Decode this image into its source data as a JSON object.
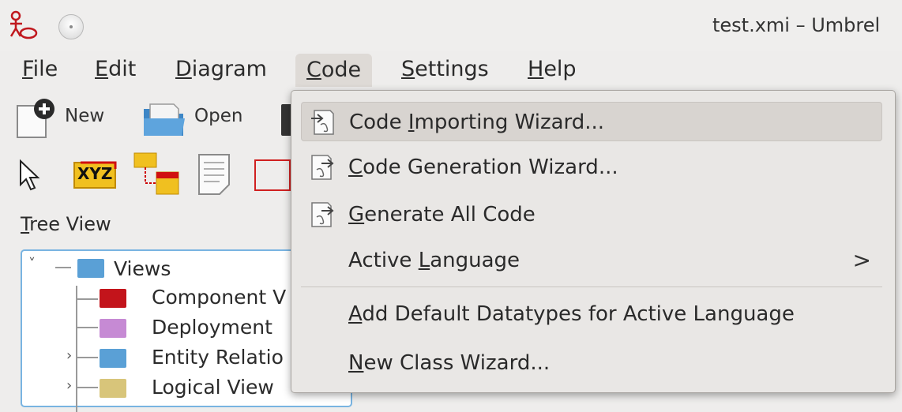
{
  "window": {
    "title": "test.xmi – Umbrel"
  },
  "menubar": {
    "items": [
      {
        "pre": "",
        "u": "F",
        "post": "ile"
      },
      {
        "pre": "",
        "u": "E",
        "post": "dit"
      },
      {
        "pre": "",
        "u": "D",
        "post": "iagram"
      },
      {
        "pre": "",
        "u": "C",
        "post": "ode"
      },
      {
        "pre": "",
        "u": "S",
        "post": "ettings"
      },
      {
        "pre": "",
        "u": "H",
        "post": "elp"
      }
    ]
  },
  "toolbar": {
    "new_label": "New",
    "open_label": "Open",
    "xyz_label": "XYZ"
  },
  "tree": {
    "title_u": "T",
    "title_rest": "ree View",
    "items": [
      {
        "label": "Views",
        "color": "#5aa0d6"
      },
      {
        "label": "Component V",
        "color": "#c3141b"
      },
      {
        "label": "Deployment",
        "color": "#c68ad4"
      },
      {
        "label": "Entity Relatio",
        "color": "#5aa0d6"
      },
      {
        "label": "Logical View",
        "color": "#d8c57a"
      }
    ]
  },
  "code_menu": {
    "items": [
      {
        "pre": "Code ",
        "u": "I",
        "post": "mporting Wizard...",
        "icon": "code-import-icon",
        "highlighted": true
      },
      {
        "pre": "",
        "u": "C",
        "post": "ode Generation Wizard...",
        "icon": "code-generate-icon"
      },
      {
        "pre": "",
        "u": "G",
        "post": "enerate All Code",
        "icon": "code-generate-icon"
      },
      {
        "pre": "Active ",
        "u": "L",
        "post": "anguage",
        "submenu": true
      },
      {
        "pre": "",
        "u": "A",
        "post": "dd Default Datatypes for Active Language"
      },
      {
        "pre": "",
        "u": "N",
        "post": "ew Class Wizard..."
      }
    ],
    "submenu_arrow": ">"
  }
}
